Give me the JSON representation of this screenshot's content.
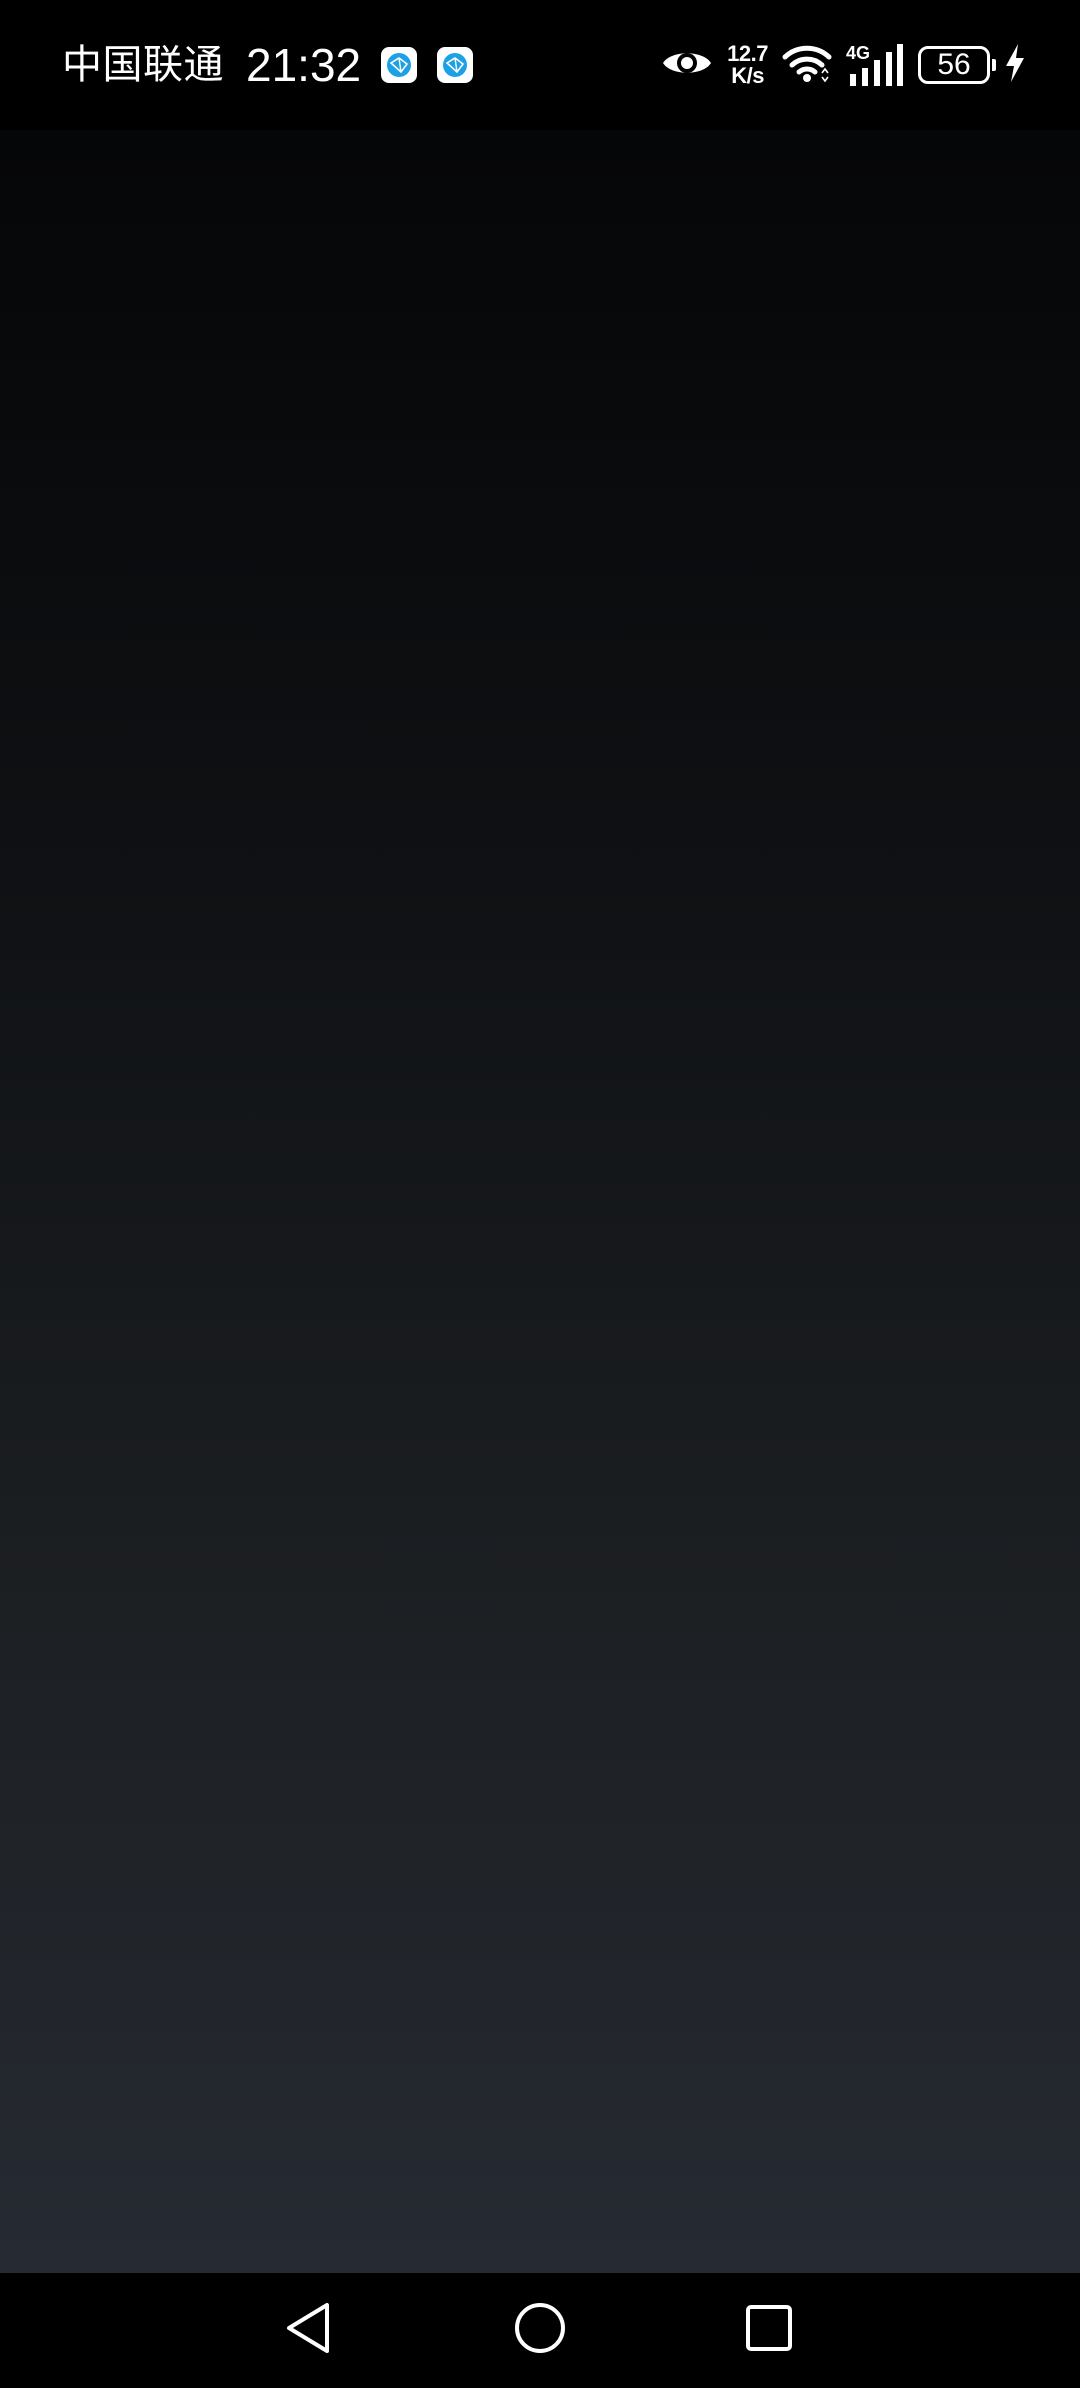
{
  "status_bar": {
    "carrier": "中国联通",
    "time": "21:32",
    "net_speed_value": "12.7",
    "net_speed_unit": "K/s",
    "network_type": "4G",
    "battery_level": "56",
    "notification_icons": [
      "app-notification-icon",
      "app-notification-icon"
    ],
    "status_icons": [
      "eye-icon",
      "wifi-icon",
      "cellular-signal-icon",
      "battery-icon",
      "charging-bolt-icon"
    ]
  },
  "navigation_bar": {
    "buttons": [
      "back-triangle-icon",
      "home-circle-icon",
      "recents-square-icon"
    ]
  },
  "colors": {
    "background_top": "#050607",
    "background_bottom": "#262a32",
    "badge_accent": "#1da1e6"
  }
}
